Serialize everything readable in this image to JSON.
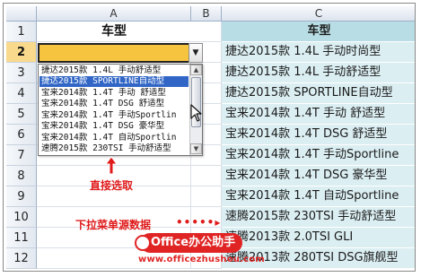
{
  "columns": [
    "A",
    "B",
    "C"
  ],
  "rows": [
    "1",
    "2",
    "3",
    "4",
    "5",
    "6",
    "7",
    "8",
    "9",
    "10",
    "11",
    "12"
  ],
  "sheet": {
    "a1_header": "车型",
    "c1_header": "车型",
    "c_values": [
      "捷达2015款 1.4L 手动时尚型",
      "捷达2015款 1.4L 手动舒适型",
      "捷达2015款 SPORTLINE自动型",
      "宝来2014款 1.4T 手动 舒适型",
      "宝来2014款 1.4T DSG 舒适型",
      "宝来2014款 1.4T 手动Sportline",
      "宝来2014款 1.4T DSG 豪华型",
      "宝来2014款 1.4T 自动Sportline",
      "速腾2015款 230TSI 手动舒适型",
      "速腾2013款 2.0TSI GLI",
      "速腾2013款 280TSI DSG旗舰型"
    ]
  },
  "dropdown": {
    "button_glyph": "▼",
    "options": [
      "捷达2015款 1.4L 手动舒适型",
      "捷达2015款 SPORTLINE自动型",
      "宝来2014款 1.4T 手动 舒适型",
      "宝来2014款 1.4T DSG 舒适型",
      "宝来2014款 1.4T 手动Sportlin",
      "宝来2014款 1.4T DSG 豪华型",
      "宝来2014款 1.4T 自动Sportlin",
      "速腾2015款 230TSI 手动舒适型"
    ],
    "highlighted_index": 1,
    "scroll_up": "▲",
    "scroll_down": "▼"
  },
  "annotations": {
    "direct_select": "直接选取",
    "source_data": "下拉菜单源数据",
    "arrow_dots": "•••••▸"
  },
  "watermark": {
    "brand": "Office办公助手",
    "url": "www.officezhushou.com"
  },
  "colors": {
    "selected_cell": "#f7c440",
    "source_column": "#dbeef2",
    "source_header": "#b8dde4",
    "highlight": "#3166c6",
    "annotation_red": "#e01a1a"
  }
}
